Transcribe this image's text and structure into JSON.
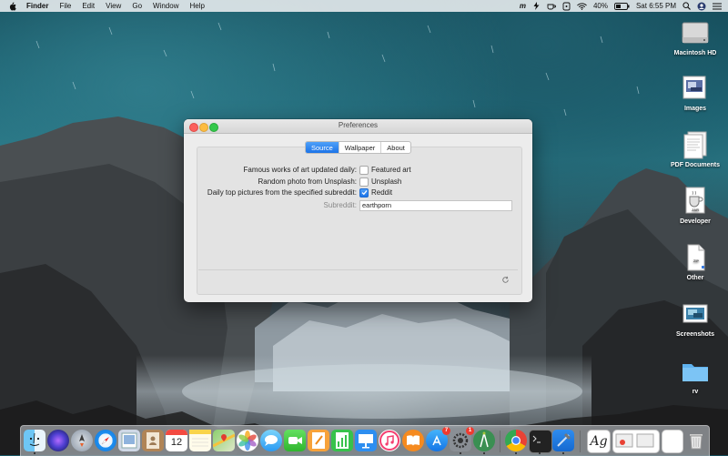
{
  "menubar": {
    "app_name": "Finder",
    "items": [
      "File",
      "Edit",
      "View",
      "Go",
      "Window",
      "Help"
    ],
    "battery": "40%",
    "clock": "Sat 6:55 PM"
  },
  "desktop_icons": [
    {
      "label": "Macintosh HD",
      "icon": "hard-drive-icon"
    },
    {
      "label": "Images",
      "icon": "folder-images-icon"
    },
    {
      "label": "PDF Documents",
      "icon": "pdf-documents-icon"
    },
    {
      "label": "Developer",
      "icon": "developer-icon"
    },
    {
      "label": "Other",
      "icon": "document-icon"
    },
    {
      "label": "Screenshots",
      "icon": "screenshots-icon"
    },
    {
      "label": "rv",
      "icon": "folder-icon"
    }
  ],
  "window": {
    "title": "Preferences",
    "tabs": [
      "Source",
      "Wallpaper",
      "About"
    ],
    "active_tab": "Source",
    "rows": [
      {
        "label": "Famous works of art updated daily:",
        "option": "Featured art",
        "checked": false
      },
      {
        "label": "Random photo from Unsplash:",
        "option": "Unsplash",
        "checked": false
      },
      {
        "label": "Daily top pictures from the specified subreddit:",
        "option": "Reddit",
        "checked": true
      }
    ],
    "subreddit_label": "Subreddit:",
    "subreddit_value": "earthporn"
  },
  "dock": {
    "apps": [
      "finder-icon",
      "siri-icon",
      "launchpad-icon",
      "safari-icon",
      "preview-icon",
      "contacts-icon",
      "calendar-icon",
      "notes-icon",
      "maps-icon",
      "photos-icon",
      "messages-icon",
      "facetime-icon",
      "pages-icon",
      "numbers-icon",
      "keynote-icon",
      "music-icon",
      "books-icon",
      "app-store-icon",
      "system-preferences-icon",
      "android-studio-icon",
      "chrome-icon",
      "terminal-icon",
      "xcode-icon",
      "font-book-icon",
      "downloads-stack-icon",
      "trash-icon"
    ],
    "calendar_date": "12",
    "app_store_badge": "7",
    "system_prefs_badge": "1"
  }
}
